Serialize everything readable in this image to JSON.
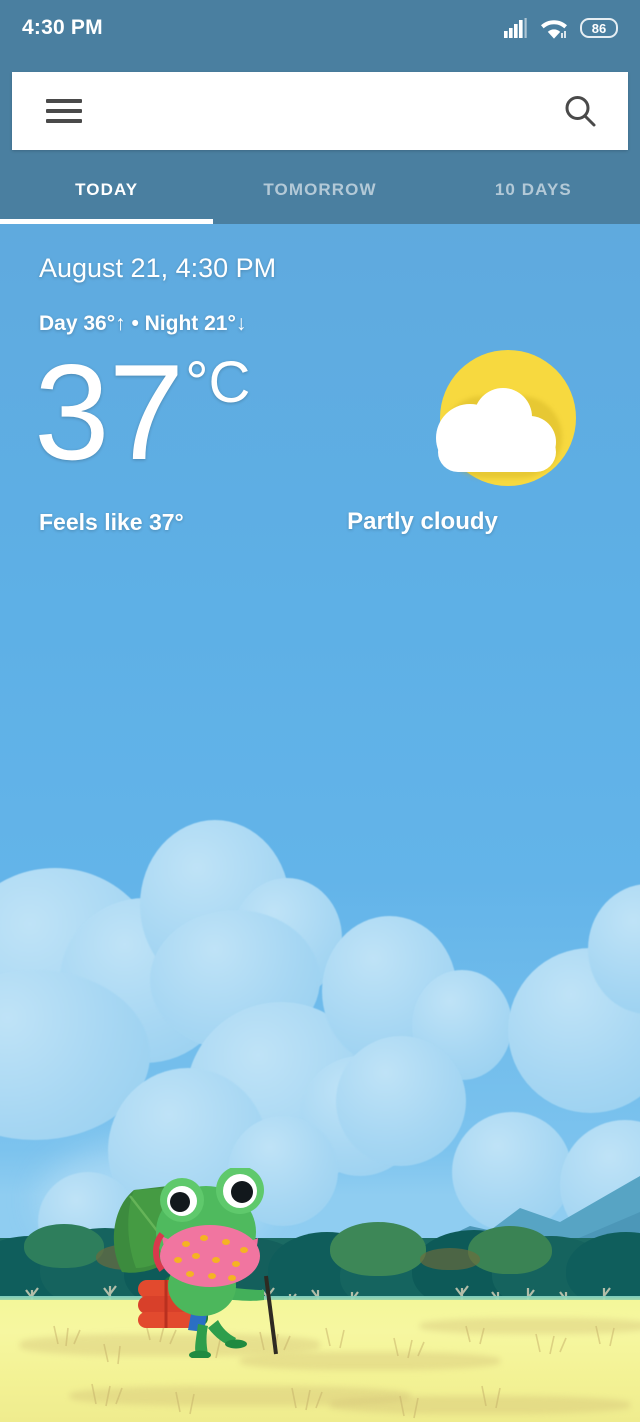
{
  "status_bar": {
    "time": "4:30 PM",
    "battery_level": "86",
    "icons": {
      "signal": "signal-bars-icon",
      "wifi": "wifi-icon",
      "battery": "battery-icon"
    }
  },
  "toolbar": {
    "menu_icon": "hamburger-menu-icon",
    "search_icon": "search-icon",
    "search_value": "",
    "search_placeholder": ""
  },
  "tabs": [
    {
      "label": "TODAY",
      "active": true
    },
    {
      "label": "TOMORROW",
      "active": false
    },
    {
      "label": "10 DAYS",
      "active": false
    }
  ],
  "current": {
    "datetime": "August 21, 4:30 PM",
    "day_night": "Day 36°↑ • Night 21°↓",
    "day_high": "36°",
    "night_low": "21°",
    "temperature": "37",
    "unit": "°C",
    "feels_like": "Feels like 37°",
    "condition": "Partly cloudy",
    "condition_icon": "partly-cloudy-icon"
  },
  "illustration": {
    "name": "frog-hiker-illustration",
    "description": "Frog hiker with leaf umbrella, backpack and walking stick in a yellow field"
  },
  "colors": {
    "toolbar": "#4A7FA0",
    "sky_top": "#5FA6D9",
    "sky_bottom": "#8FCDF1",
    "accent_white": "#FFFFFF",
    "sun_yellow": "#F7D93F",
    "field_yellow": "#F4F79A",
    "tree_green": "#1D6B63",
    "mountain_blue": "#4C97B8"
  }
}
